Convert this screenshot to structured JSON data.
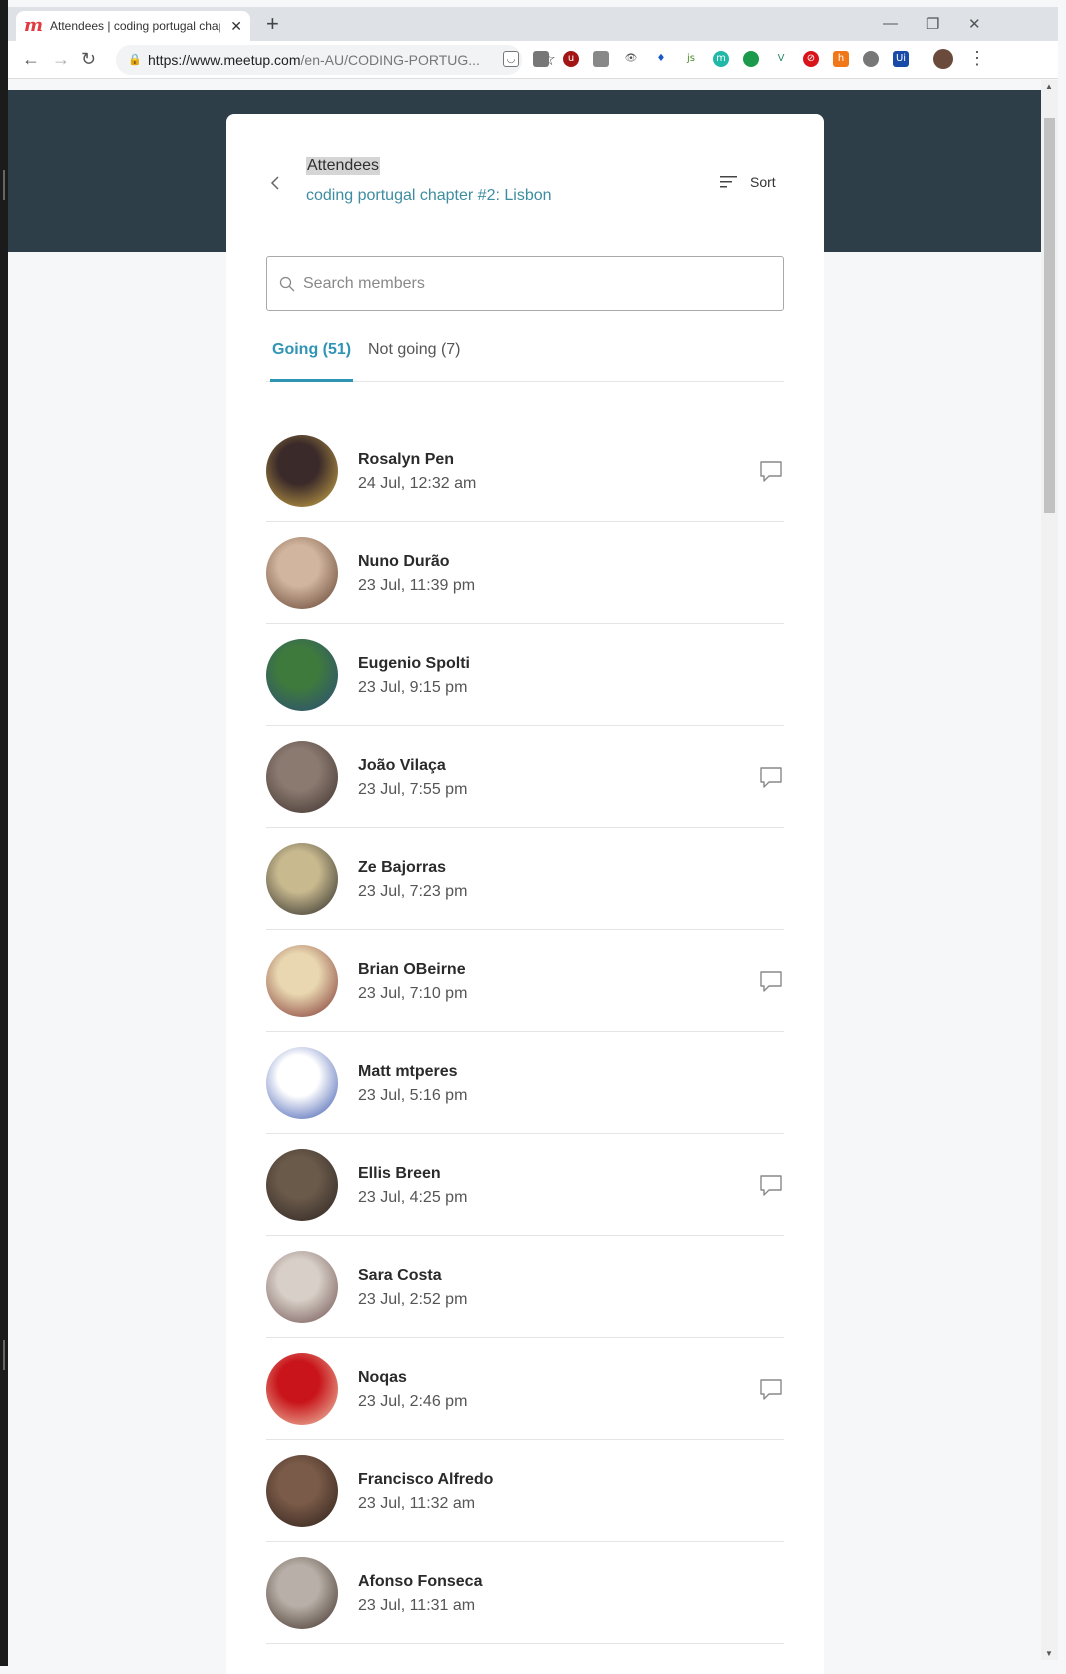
{
  "browser": {
    "tab_title": "Attendees | coding portugal chap",
    "url_host": "https://www.meetup.com",
    "url_path": "/en-AU/CODING-PORTUG..."
  },
  "header": {
    "title": "Attendees",
    "subtitle": "coding portugal chapter #2: Lisbon",
    "sort_label": "Sort"
  },
  "search": {
    "placeholder": "Search members"
  },
  "tabs": [
    {
      "label": "Going (51)"
    },
    {
      "label": "Not going (7)"
    }
  ],
  "attendees": [
    {
      "name": "Rosalyn Pen",
      "time": "24 Jul, 12:32 am",
      "message": true,
      "avatar_colors": [
        "#3b2a2a",
        "#d7b24a"
      ]
    },
    {
      "name": "Nuno Durão",
      "time": "23 Jul, 11:39 pm",
      "message": false,
      "avatar_colors": [
        "#d2b59e",
        "#5a3b2a"
      ]
    },
    {
      "name": "Eugenio Spolti",
      "time": "23 Jul, 9:15 pm",
      "message": false,
      "avatar_colors": [
        "#3f7a3d",
        "#2a4a7a"
      ]
    },
    {
      "name": "João Vilaça",
      "time": "23 Jul, 7:55 pm",
      "message": true,
      "avatar_colors": [
        "#8b7a70",
        "#3a2e2a"
      ]
    },
    {
      "name": "Ze Bajorras",
      "time": "23 Jul, 7:23 pm",
      "message": false,
      "avatar_colors": [
        "#c8b98e",
        "#222222"
      ]
    },
    {
      "name": "Brian OBeirne",
      "time": "23 Jul, 7:10 pm",
      "message": true,
      "avatar_colors": [
        "#e8d7b0",
        "#7a2a2a"
      ]
    },
    {
      "name": "Matt mtperes",
      "time": "23 Jul, 5:16 pm",
      "message": false,
      "avatar_colors": [
        "#ffffff",
        "#2c4aa8"
      ]
    },
    {
      "name": "Ellis Breen",
      "time": "23 Jul, 4:25 pm",
      "message": true,
      "avatar_colors": [
        "#6a5a4a",
        "#2a2220"
      ]
    },
    {
      "name": "Sara Costa",
      "time": "23 Jul, 2:52 pm",
      "message": false,
      "avatar_colors": [
        "#d8d0c8",
        "#6a4a4a"
      ]
    },
    {
      "name": "Noqas",
      "time": "23 Jul, 2:46 pm",
      "message": true,
      "avatar_colors": [
        "#c8141a",
        "#f0d2b4"
      ]
    },
    {
      "name": "Francisco Alfredo",
      "time": "23 Jul, 11:32 am",
      "message": false,
      "avatar_colors": [
        "#7a5a48",
        "#2a1e18"
      ]
    },
    {
      "name": "Afonso Fonseca",
      "time": "23 Jul, 11:31 am",
      "message": false,
      "avatar_colors": [
        "#b8b0a8",
        "#3a2a22"
      ]
    }
  ],
  "colors": {
    "accent": "#3094b4",
    "banner": "#2e3e48",
    "subtitle": "#3d8da0"
  }
}
